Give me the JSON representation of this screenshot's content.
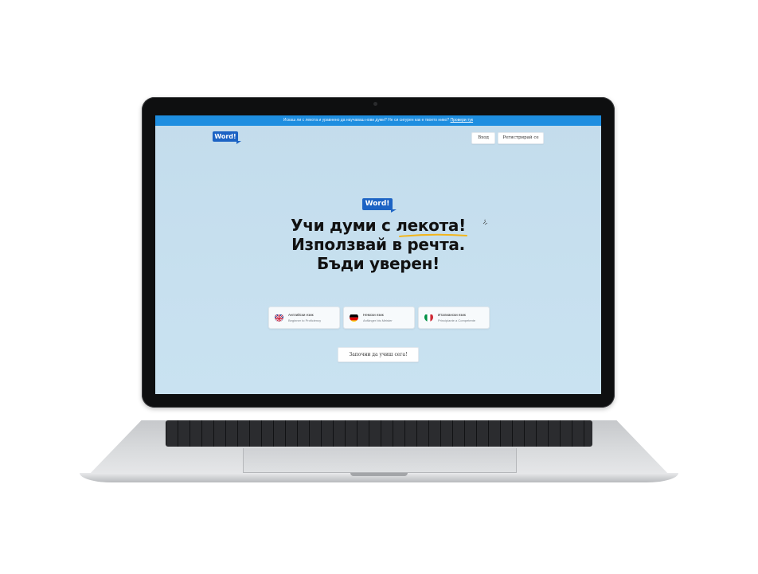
{
  "banner": {
    "text": "Искаш ли с лекота и уравнено да научаваш нови думи? Не си сигурен как е твоето ниво?",
    "link": "Провери тук"
  },
  "header": {
    "logo": "Word!",
    "login_label": "Вход",
    "register_label": "Регистрирай се"
  },
  "hero": {
    "logo": "Word!",
    "line1": "Учи думи с лекота!",
    "line2": "Използвай в речта.",
    "line3": "Бъди уверен!"
  },
  "languages": [
    {
      "title": "Английски език",
      "subtitle": "Beginner to Proficiency",
      "flag": "uk-flag-icon"
    },
    {
      "title": "Немски език",
      "subtitle": "Anfänger bis Meister",
      "flag": "germany-flag-icon"
    },
    {
      "title": "Италиански език",
      "subtitle": "Principiante a Competente",
      "flag": "italy-flag-icon"
    }
  ],
  "cta_label": "Започни да учиш сега!",
  "colors": {
    "banner": "#1e8ee0",
    "brand": "#1c63c4",
    "screen_bg": "#c5ddee",
    "underline": "#f2b51c"
  }
}
